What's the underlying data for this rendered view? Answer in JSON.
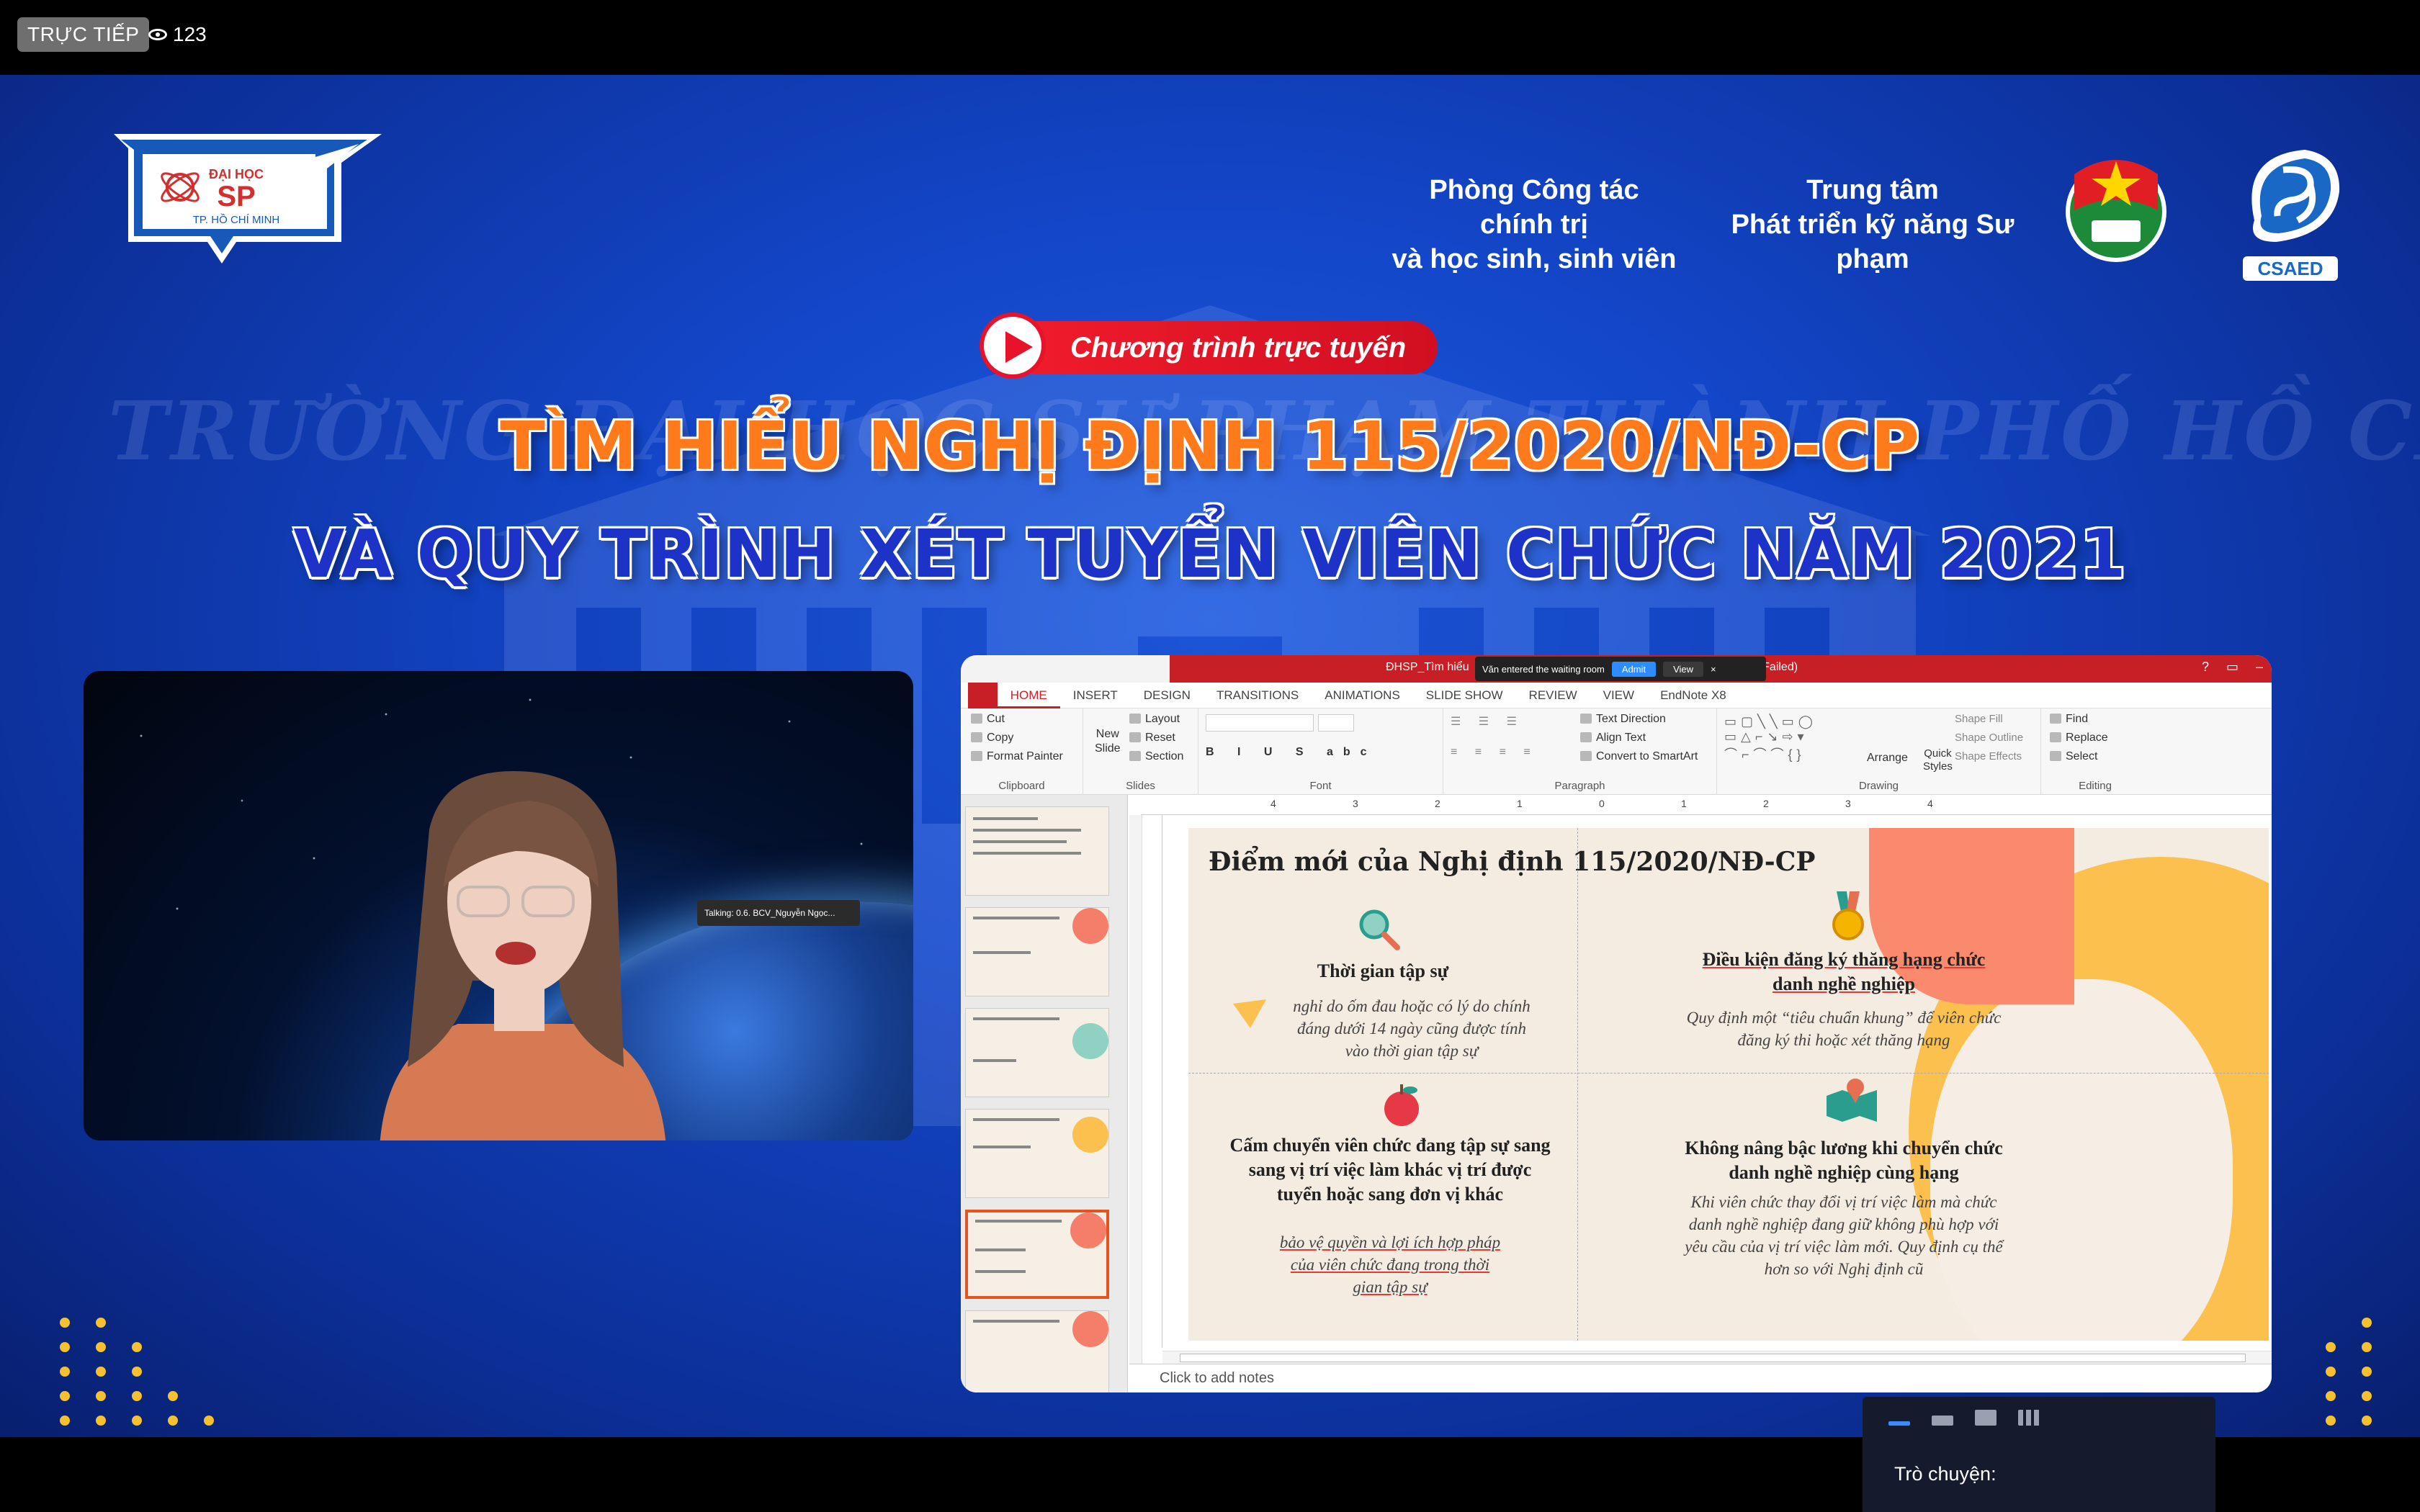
{
  "stream": {
    "live_label": "TRỰC TIẾP",
    "viewer_count": "123"
  },
  "banner": {
    "logo_line1": "ĐẠI HỌC",
    "logo_line2": "SP",
    "logo_line3": "TP. HỒ CHÍ MINH",
    "org1_line1": "Phòng Công tác chính trị",
    "org1_line2": "và học sinh, sinh viên",
    "org2_line1": "Trung tâm",
    "org2_line2": "Phát triển kỹ năng Sư phạm",
    "csaed_label": "CSAED",
    "program_label": "Chương trình trực tuyến",
    "title_line1": "TÌM HIỂU NGHỊ ĐỊNH 115/2020/NĐ-CP",
    "title_line2": "VÀ QUY TRÌNH XÉT TUYỂN VIÊN CHỨC NĂM 2021",
    "watermark": "TRƯỜNG ĐẠI HỌC SƯ PHẠM THÀNH PHỐ HỒ CHÍ MINH"
  },
  "share": {
    "window_title": "ĐHSP_Tìm hiểu",
    "window_title_tail": "ctivation Failed)",
    "waiting_text": "Văn entered the waiting room",
    "admit_label": "Admit",
    "view_label": "View",
    "close_label": "×",
    "help_label": "?",
    "tabs": [
      "HOME",
      "INSERT",
      "DESIGN",
      "TRANSITIONS",
      "ANIMATIONS",
      "SLIDE SHOW",
      "REVIEW",
      "VIEW",
      "EndNote X8"
    ],
    "ribbon": {
      "cut": "Cut",
      "copy": "Copy",
      "format_painter": "Format Painter",
      "clipboard": "Clipboard",
      "new_slide_1": "New",
      "new_slide_2": "Slide",
      "layout": "Layout",
      "reset": "Reset",
      "section": "Section",
      "slides": "Slides",
      "font": "Font",
      "text_direction": "Text Direction",
      "align_text": "Align Text",
      "convert_smartart": "Convert to SmartArt",
      "paragraph": "Paragraph",
      "arrange": "Arrange",
      "quick_styles_1": "Quick",
      "quick_styles_2": "Styles",
      "shape_fill": "Shape Fill",
      "shape_outline": "Shape Outline",
      "shape_effects": "Shape Effects",
      "drawing": "Drawing",
      "find": "Find",
      "replace": "Replace",
      "select": "Select",
      "editing": "Editing"
    },
    "ruler_numbers": [
      "4",
      "3",
      "2",
      "1",
      "0",
      "1",
      "2",
      "3",
      "4"
    ],
    "speaking": "Talking: 0.6. BCV_Nguyễn Ngọc...",
    "notes_placeholder": "Click to add notes",
    "slide": {
      "title": "Điểm mới của Nghị định 115/2020/NĐ-CP",
      "q1_head": "Thời gian tập sự",
      "q1_body": [
        "nghỉ do ốm đau hoặc có lý do chính",
        "đáng dưới 14 ngày cũng được tính",
        "vào thời gian tập sự"
      ],
      "q2_head": [
        "Điều kiện đăng ký thăng hạng chức",
        "danh nghề nghiệp"
      ],
      "q2_body": [
        "Quy định một “tiêu chuẩn khung” để viên chức",
        "đăng ký thi hoặc xét thăng hạng"
      ],
      "q3_head": [
        "Cấm chuyển viên chức đang tập sự sang",
        "sang vị trí việc làm khác vị trí được",
        "tuyển hoặc sang đơn vị khác"
      ],
      "q3_body": [
        "bảo vệ quyền và lợi ích hợp pháp",
        "của viên chức đang trong thời",
        "gian tập sự"
      ],
      "q4_head": [
        "Không nâng bậc lương khi chuyển chức",
        "danh nghề nghiệp cùng hạng"
      ],
      "q4_body": [
        "Khi viên chức thay đổi vị trí việc làm mà chức",
        "danh nghề nghiệp đang giữ không phù hợp với",
        "yêu cầu của vị trí việc làm mới. Quy định cụ thể",
        "hơn so với Nghị định cũ"
      ]
    },
    "thumbnail_caption": "Điểm mới của Nghị định 115/2020/NĐ-CP"
  },
  "chat": {
    "label": "Trò chuyện:"
  },
  "colors": {
    "brand_blue": "#1346c8",
    "title_orange": "#ff7a1a",
    "title_navy": "#1d33c8",
    "accent_red": "#e8122a",
    "ppt_red": "#c81f26"
  }
}
